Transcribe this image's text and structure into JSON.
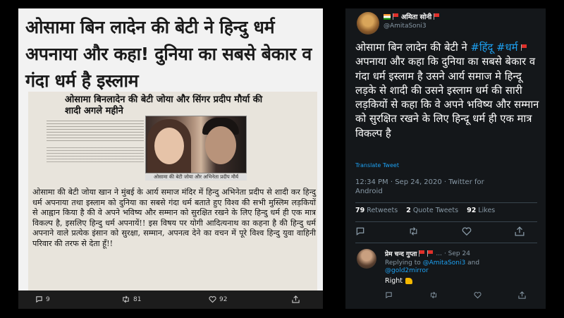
{
  "left_panel": {
    "headline": "ओसामा बिन लादेन की बेटी ने हिन्दु धर्म अपनाया और कहा! दुनिया का सबसे बेकार व गंदा धर्म है इस्लाम",
    "clipping": {
      "title": "ओसामा बिनलादेन की बेटी जोया और सिंगर प्रदीप मौर्या की शादी अगले महीने",
      "photo_caption": "ओसामा की बेटी जोया और अभिनेता प्रदीप मौर्य",
      "article": "ओसामा की बेटी जोया खान ने मुंबई के आर्य समाज मंदिर में हिन्दु अभिनेता प्रदीप से शादी कर हिन्दु धर्म अपनाया तथा इस्लाम को दुनिया का सबसे गंदा धर्म बताते हुए विश्व की सभी मुस्लिम लड़कियों से आह्वान किया है की वे अपने भविष्य और सम्मान को सुरक्षित रखने के लिए हिन्दु धर्म ही एक मात्र विकल्प है, इसलिए हिन्दु धर्म अपनायें!! इस विषय पर योगी आदित्यनाथ का कहना है की हिन्दु धर्म अपनाने वाले प्रत्येक इंसान को सुरक्षा, सम्मान, अपनत्व देने का वचन में पूरे विश्व हिन्दु युवा वाहिनी परिवार की तरफ से देता हूँ!!"
    },
    "actions": {
      "replies": "9",
      "retweets": "81",
      "likes": "92"
    }
  },
  "right_panel": {
    "username": "अमिता सोनी",
    "handle": "@AmitaSoni3",
    "tweet": {
      "pre": "ओसामा बिन लादेन की बेटी ने ",
      "hashtag1": "#हिंदू",
      "hashtag2": "#धर्म",
      "post": " अपनाया और कहा कि दुनिया का सबसे बेकार व गंदा धर्म इस्लाम है उसने आर्य समाज मे हिन्दू लड़के से शादी की उसने इस्लाम धर्म की सारी लड़कियों से कहा कि वे अपने भविष्य और सम्मान को सुरक्षित रखने के लिए हिन्दू धर्म ही एक मात्र विकल्प है"
    },
    "translate": "Translate Tweet",
    "meta": "12:34 PM · Sep 24, 2020 · Twitter for Android",
    "stats": {
      "retweets": "79",
      "retweets_label": "Retweets",
      "quotes": "2",
      "quotes_label": "Quote Tweets",
      "likes": "92",
      "likes_label": "Likes"
    },
    "reply": {
      "name": "प्रेम चन्द गुप्ता",
      "ellipsis": "...",
      "date": "· Sep 24",
      "replying_prefix": "Replying to ",
      "replying_to_1": "@AmitaSoni3",
      "replying_and": " and",
      "replying_to_2": "@gold2mirror",
      "text": "Right"
    }
  },
  "colors": {
    "link": "#1da1f2",
    "dark_bg": "#14171a",
    "muted": "#8899a6"
  }
}
